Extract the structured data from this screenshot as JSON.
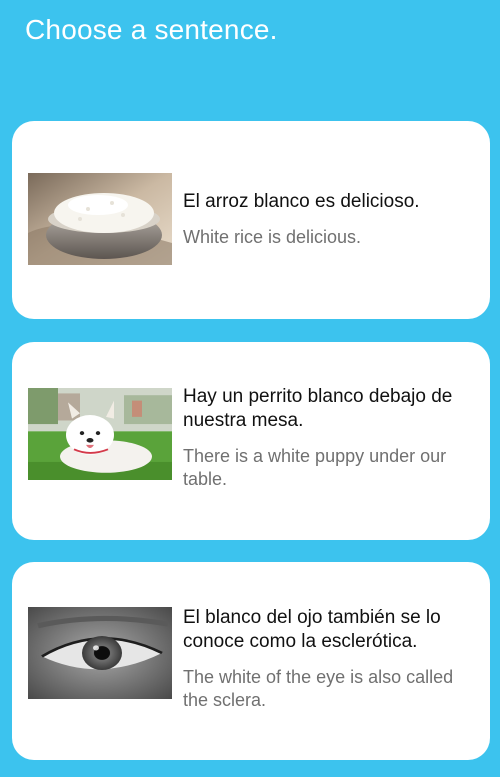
{
  "header": {
    "title": "Choose a sentence."
  },
  "options": [
    {
      "spanish": "El arroz blanco es delicioso.",
      "english": "White rice is delicious.",
      "image": "white-rice-bowl"
    },
    {
      "spanish": "Hay un perrito blanco debajo de nuestra mesa.",
      "english": "There is a white puppy under our table.",
      "image": "white-puppy"
    },
    {
      "spanish": "El blanco del ojo también se lo conoce como la esclerótica.",
      "english": "The white of the eye is also called the sclera.",
      "image": "eye-closeup"
    }
  ]
}
